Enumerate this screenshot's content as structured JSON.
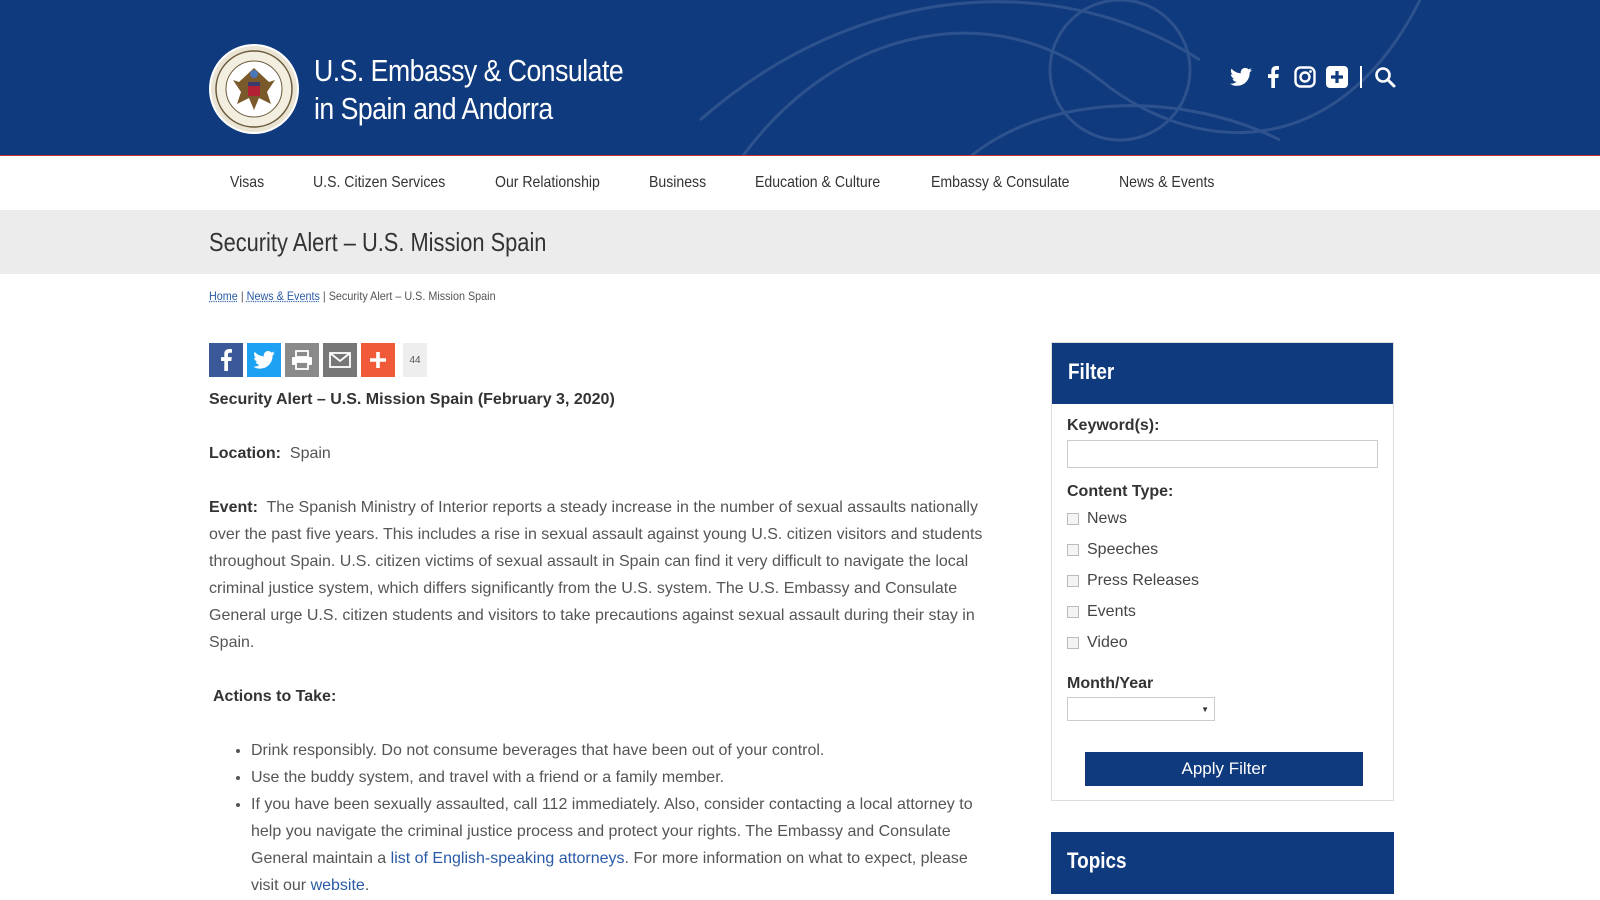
{
  "header": {
    "title_line1": "U.S. Embassy & Consulate",
    "title_line2": "in Spain and Andorra",
    "social_icons": [
      "twitter-icon",
      "facebook-icon",
      "instagram-icon",
      "plus-icon",
      "search-icon"
    ],
    "brand_color": "#0f3a7d",
    "accent_color": "#c8353c"
  },
  "nav": {
    "items": [
      "Visas",
      "U.S. Citizen Services",
      "Our Relationship",
      "Business",
      "Education & Culture",
      "Embassy & Consulate",
      "News & Events"
    ]
  },
  "page": {
    "title": "Security Alert – U.S. Mission Spain"
  },
  "breadcrumb": {
    "home": "Home",
    "sep": "|",
    "news": "News & Events",
    "current": "Security Alert – U.S. Mission Spain"
  },
  "share": {
    "icons": [
      "facebook-icon",
      "twitter-icon",
      "print-icon",
      "email-icon",
      "plus-icon"
    ],
    "count": "44"
  },
  "article": {
    "heading": "Security Alert – U.S. Mission Spain (February 3, 2020)",
    "location_label": "Location:",
    "location_value": "Spain",
    "event_label": "Event:",
    "event_text": "The Spanish Ministry of Interior reports a steady increase in the number of sexual assaults nationally over the past five years.  This includes a rise in sexual assault against young U.S. citizen visitors and students throughout Spain.  U.S. citizen victims of sexual assault in Spain can find it very difficult to navigate the local criminal justice system, which differs significantly from the U.S. system.  The U.S. Embassy and Consulate General urge U.S. citizen students and visitors to take precautions against sexual assault during their stay in Spain.",
    "actions_label": "Actions to Take:",
    "bullet1": "Drink responsibly.  Do not consume beverages that have been out of your control.",
    "bullet2": "Use the buddy system, and travel with a friend or a family member.",
    "bullet3_pre": "If you have been sexually assaulted, call 112 immediately.  Also, consider contacting a local attorney to help you navigate the criminal justice process and protect your rights.  The Embassy and Consulate General maintain a ",
    "bullet3_link1": "list of English-speaking attorneys",
    "bullet3_mid": ".  For more information on what to expect, please visit our ",
    "bullet3_link2": "website",
    "bullet3_end": "."
  },
  "filter": {
    "title": "Filter",
    "keyword_label": "Keyword(s):",
    "keyword_value": "",
    "content_type_label": "Content Type:",
    "content_types": [
      "News",
      "Speeches",
      "Press Releases",
      "Events",
      "Video"
    ],
    "month_year_label": "Month/Year",
    "month_year_value": "",
    "apply_label": "Apply Filter"
  },
  "topics": {
    "title": "Topics"
  }
}
